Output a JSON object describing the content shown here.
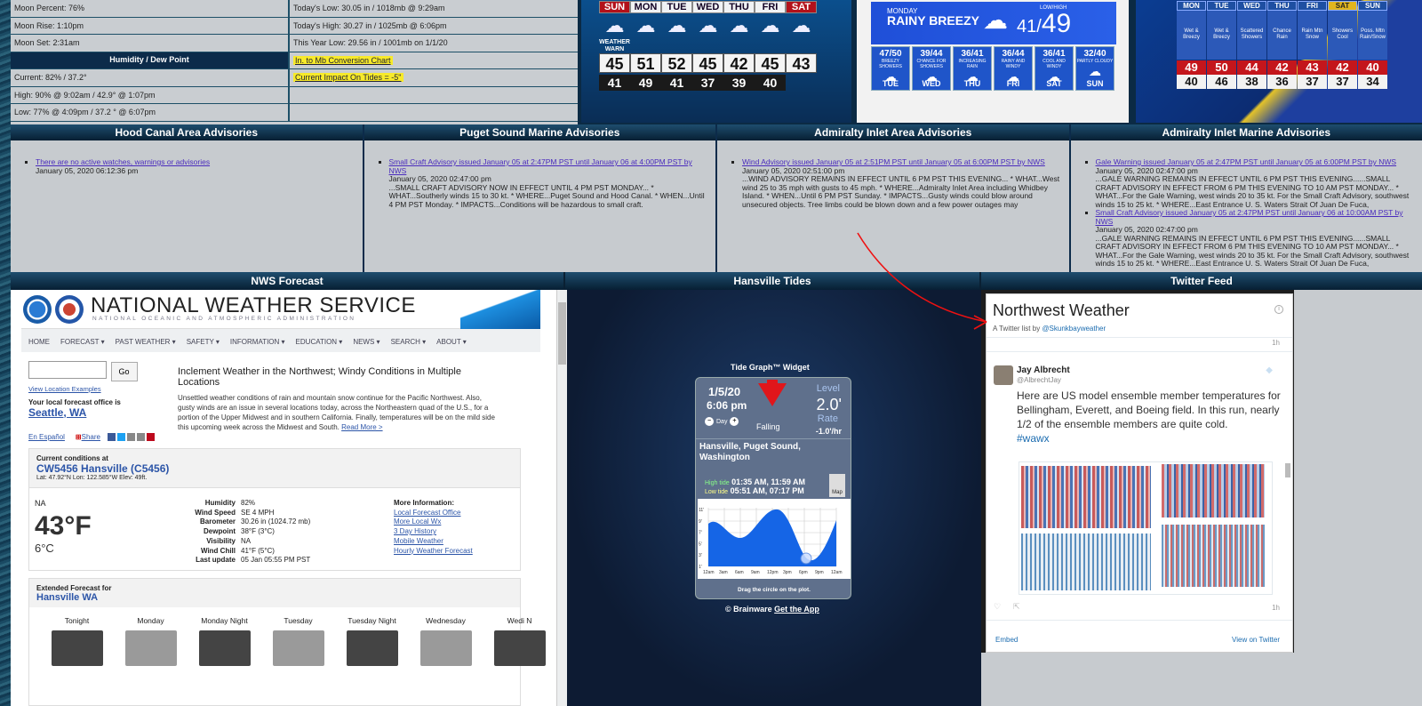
{
  "stats": {
    "rows": [
      {
        "left": "Moon Percent: 76%",
        "right": "Today's Low:  30.05 in / 1018mb  @ 9:29am"
      },
      {
        "left": "Moon Rise: 1:10pm",
        "right": "Today's High:  30.27 in / 1025mb  @ 6:06pm"
      },
      {
        "left": "Moon Set: 2:31am",
        "right": "This Year Low: 29.56 in / 1001mb  on 1/1/20"
      }
    ],
    "humidity_header": "Humidity / Dew Point",
    "conversion_link": "In. to Mb Conversion Chart",
    "humidity_rows": [
      {
        "left": "Current:  82%  /  37.2°",
        "right": "Current Impact On Tides = -5\""
      },
      {
        "left": "High:  90% @  9:02am / 42.9° @ 1:07pm",
        "right": ""
      },
      {
        "left": "Low:  77% @  4:09pm / 37.2 ° @ 6:07pm",
        "right": ""
      }
    ]
  },
  "panel1": {
    "days": [
      "SUN",
      "MON",
      "TUE",
      "WED",
      "THU",
      "FRI",
      "SAT"
    ],
    "badge": "WEATHER WARN DAY",
    "highs": [
      "45",
      "51",
      "52",
      "45",
      "42",
      "45",
      "43"
    ],
    "lows": [
      "41",
      "49",
      "41",
      "37",
      "39",
      "40"
    ]
  },
  "panel2": {
    "day": "MONDAY",
    "condition": "RAINY BREEZY",
    "lowhigh_label": "LOW/HIGH",
    "low": "41/",
    "high": "49",
    "days": [
      {
        "name": "TUE",
        "temps": "47/50",
        "note": "BREEZY SHOWERS"
      },
      {
        "name": "WED",
        "temps": "39/44",
        "note": "CHANCE FOR SHOWERS"
      },
      {
        "name": "THU",
        "temps": "36/41",
        "note": "INCREASING RAIN"
      },
      {
        "name": "FRI",
        "temps": "36/44",
        "note": "RAINY AND WINDY"
      },
      {
        "name": "SAT",
        "temps": "36/41",
        "note": "COOL AND WINDY"
      },
      {
        "name": "SUN",
        "temps": "32/40",
        "note": "PARTLY CLOUDY"
      }
    ]
  },
  "panel3": {
    "days": [
      "MON",
      "TUE",
      "WED",
      "THU",
      "FRI",
      "SAT",
      "SUN"
    ],
    "conds": [
      "Wet & Breezy",
      "Wet & Breezy",
      "Scattered Showers",
      "Chance Rain",
      "Rain Mtn Snow",
      "Showers Cool",
      "Poss. Mtn Rain/Snow"
    ],
    "highs": [
      "49",
      "50",
      "44",
      "42",
      "43",
      "42",
      "40"
    ],
    "lows": [
      "40",
      "46",
      "38",
      "36",
      "37",
      "37",
      "34"
    ]
  },
  "advisories": [
    {
      "title": "Hood Canal Area Advisories",
      "items": [
        {
          "link": "There are no active watches, warnings or advisories",
          "date": "January 05, 2020 06:12:36 pm",
          "text": ""
        }
      ]
    },
    {
      "title": "Puget Sound Marine Advisories",
      "items": [
        {
          "link": "Small Craft Advisory issued January 05 at 2:47PM PST until January 06 at 4:00PM PST by NWS",
          "date": "January 05, 2020 02:47:00 pm",
          "text": "...SMALL CRAFT ADVISORY NOW IN EFFECT UNTIL 4 PM PST MONDAY... * WHAT...Southerly winds 15 to 30 kt. * WHERE...Puget Sound and Hood Canal. * WHEN...Until 4 PM PST Monday. * IMPACTS...Conditions will be hazardous to small craft."
        }
      ]
    },
    {
      "title": "Admiralty Inlet Area Advisories",
      "items": [
        {
          "link": "Wind Advisory issued January 05 at 2:51PM PST until January 05 at 6:00PM PST by NWS",
          "date": "January 05, 2020 02:51:00 pm",
          "text": "...WIND ADVISORY REMAINS IN EFFECT UNTIL 6 PM PST THIS EVENING... * WHAT...West wind 25 to 35 mph with gusts to 45 mph. * WHERE...Admiralty Inlet Area including Whidbey Island. * WHEN...Until 6 PM PST Sunday. * IMPACTS...Gusty winds could blow around unsecured objects. Tree limbs could be blown down and a few power outages may"
        }
      ]
    },
    {
      "title": "Admiralty Inlet Marine Advisories",
      "items": [
        {
          "link": "Gale Warning issued January 05 at 2:47PM PST until January 05 at 6:00PM PST by NWS",
          "date": "January 05, 2020 02:47:00 pm",
          "text": "...GALE WARNING REMAINS IN EFFECT UNTIL 6 PM PST THIS EVENING......SMALL CRAFT ADVISORY IN EFFECT FROM 6 PM THIS EVENING TO 10 AM PST MONDAY... * WHAT...For the Gale Warning, west winds 20 to 35 kt. For the Small Craft Advisory, southwest winds 15 to 25 kt. * WHERE...East Entrance U. S. Waters Strait Of Juan De Fuca,"
        },
        {
          "link": "Small Craft Advisory issued January 05 at 2:47PM PST until January 06 at 10:00AM PST by NWS",
          "date": "January 05, 2020 02:47:00 pm",
          "text": "...GALE WARNING REMAINS IN EFFECT UNTIL 6 PM PST THIS EVENING......SMALL CRAFT ADVISORY IN EFFECT FROM 6 PM THIS EVENING TO 10 AM PST MONDAY... * WHAT...For the Gale Warning, west winds 20 to 35 kt. For the Small Craft Advisory, southwest winds 15 to 25 kt. * WHERE...East Entrance U. S. Waters Strait Of Juan De Fuca,"
        }
      ]
    }
  ],
  "sections": {
    "nws": "NWS Forecast",
    "tides": "Hansville Tides",
    "twitter": "Twitter Feed"
  },
  "nws": {
    "title": "NATIONAL WEATHER SERVICE",
    "subtitle": "NATIONAL OCEANIC AND ATMOSPHERIC ADMINISTRATION",
    "menu": [
      "HOME",
      "FORECAST ▾",
      "PAST WEATHER ▾",
      "SAFETY ▾",
      "INFORMATION ▾",
      "EDUCATION ▾",
      "NEWS ▾",
      "SEARCH ▾",
      "ABOUT ▾"
    ],
    "go": "Go",
    "location_examples": "View Location Examples",
    "office_label": "Your local forecast office is",
    "office": "Seattle, WA",
    "lang": "En Español",
    "share": "Share",
    "headline": "Inclement Weather in the Northwest; Windy Conditions in Multiple Locations",
    "body": "Unsettled weather conditions of rain and mountain snow continue for the Pacific Northwest. Also, gusty winds are an issue in several locations today, across the Northeastern quad of the U.S., for a portion of the Upper Midwest and in southern California. Finally, temperatures will be on the mild side this upcoming week across the Midwest and South.",
    "read_more": "Read More >",
    "cc_label": "Current conditions at",
    "cc_station": "CW5456 Hansville (C5456)",
    "cc_latlon": "Lat: 47.92°N   Lon: 122.585°W   Elev: 49ft.",
    "cond": "NA",
    "temp_f": "43°F",
    "temp_c": "6°C",
    "details": [
      {
        "k": "Humidity",
        "v": "82%"
      },
      {
        "k": "Wind Speed",
        "v": "SE 4 MPH"
      },
      {
        "k": "Barometer",
        "v": "30.26 in (1024.72 mb)"
      },
      {
        "k": "Dewpoint",
        "v": "38°F (3°C)"
      },
      {
        "k": "Visibility",
        "v": "NA"
      },
      {
        "k": "Wind Chill",
        "v": "41°F (5°C)"
      },
      {
        "k": "Last update",
        "v": "05 Jan 05:55 PM PST"
      }
    ],
    "more_label": "More Information:",
    "more_links": [
      "Local Forecast Office",
      "More Local Wx",
      "3 Day History",
      "Mobile Weather",
      "Hourly Weather Forecast"
    ],
    "ext_label": "Extended Forecast for",
    "ext_loc": "Hansville WA",
    "ext_days": [
      "Tonight",
      "Monday",
      "Monday Night",
      "Tuesday",
      "Tuesday Night",
      "Wednesday",
      "Wedi N"
    ]
  },
  "tides": {
    "widget_title": "Tide Graph™ Widget",
    "date": "1/5/20",
    "time": "6:06 pm",
    "day": "Day",
    "level_label": "Level",
    "level": "2.0'",
    "rate_label": "Rate",
    "rate": "-1.0'/hr",
    "trend": "Falling",
    "location": "Hansville, Puget Sound, Washington",
    "high_label": "High tide",
    "high": "01:35 AM, 11:59 AM",
    "low_label": "Low tide",
    "low": "05:51 AM, 07:17 PM",
    "map": "Map",
    "yticks": [
      "11'",
      "9'",
      "7'",
      "5'",
      "3'",
      "1'"
    ],
    "xticks": [
      "12am",
      "3am",
      "6am",
      "9am",
      "12pm",
      "3pm",
      "6pm",
      "9pm",
      "12am"
    ],
    "drag": "Drag the circle on the plot.",
    "footer": "© Brainware",
    "footer_link": "Get the App"
  },
  "twitter": {
    "title": "Northwest Weather",
    "subtitle_prefix": "A Twitter list by",
    "subtitle_handle": "@Skunkbayweather",
    "time1": "1h",
    "name": "Jay Albrecht",
    "handle": "@AlbrechtJay",
    "tweet": "Here are US model ensemble member temperatures for Bellingham, Everett, and Boeing field. In this run, nearly 1/2 of the ensemble members are quite cold.",
    "hashtag": "#wawx",
    "time2": "1h",
    "embed": "Embed",
    "view": "View on Twitter"
  }
}
